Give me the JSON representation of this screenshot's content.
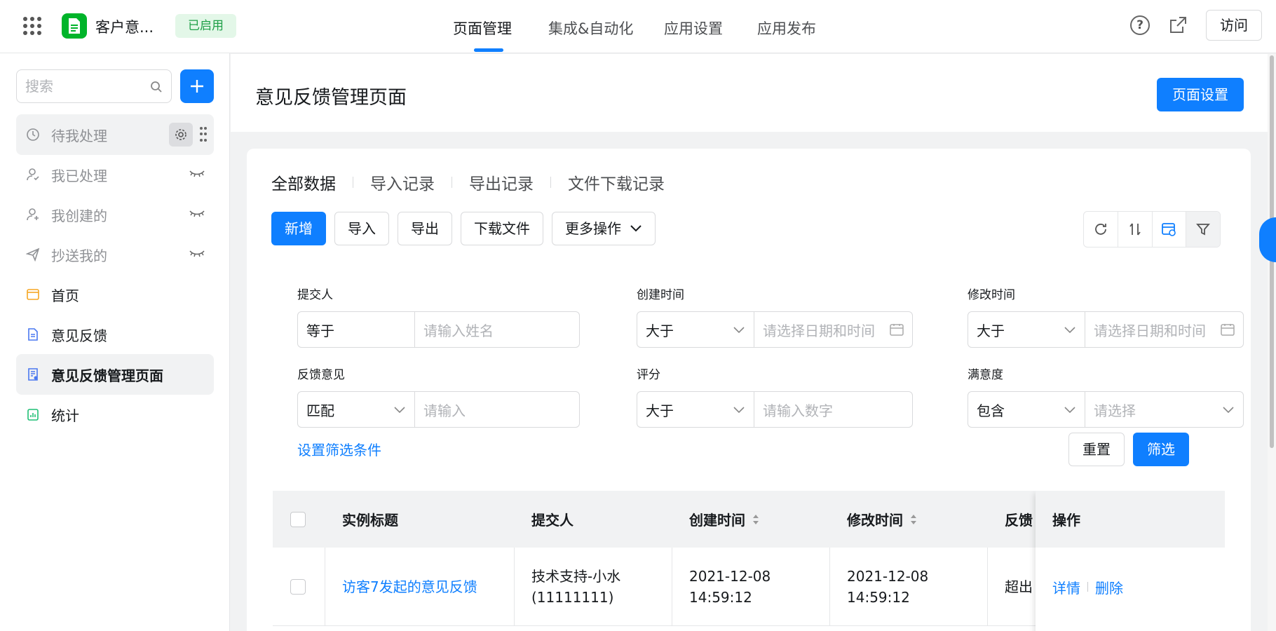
{
  "header": {
    "app_name": "客户意...",
    "status_badge": "已启用",
    "nav_tabs": [
      "页面管理",
      "集成&自动化",
      "应用设置",
      "应用发布"
    ],
    "active_tab": "页面管理",
    "visit_label": "访问"
  },
  "sidebar": {
    "search_placeholder": "搜索",
    "items": [
      {
        "label": "待我处理",
        "icon": "clock-icon"
      },
      {
        "label": "我已处理",
        "icon": "user-check-icon"
      },
      {
        "label": "我创建的",
        "icon": "user-add-icon"
      },
      {
        "label": "抄送我的",
        "icon": "send-icon"
      },
      {
        "label": "首页",
        "icon": "home-page-icon"
      },
      {
        "label": "意见反馈",
        "icon": "document-icon"
      },
      {
        "label": "意见反馈管理页面",
        "icon": "report-icon"
      },
      {
        "label": "统计",
        "icon": "chart-icon"
      }
    ]
  },
  "page": {
    "title": "意见反馈管理页面",
    "settings_label": "页面设置"
  },
  "sub_tabs": [
    "全部数据",
    "导入记录",
    "导出记录",
    "文件下载记录"
  ],
  "toolbar": {
    "add_label": "新增",
    "import_label": "导入",
    "export_label": "导出",
    "download_label": "下载文件",
    "more_label": "更多操作"
  },
  "filters": [
    {
      "label": "提交人",
      "operator": "等于",
      "placeholder": "请输入姓名"
    },
    {
      "label": "创建时间",
      "operator": "大于",
      "placeholder": "请选择日期和时间"
    },
    {
      "label": "修改时间",
      "operator": "大于",
      "placeholder": "请选择日期和时间"
    },
    {
      "label": "反馈意见",
      "operator": "匹配",
      "placeholder": "请输入"
    },
    {
      "label": "评分",
      "operator": "大于",
      "placeholder": "请输入数字"
    },
    {
      "label": "满意度",
      "operator": "包含",
      "placeholder": "请选择"
    }
  ],
  "filter_actions": {
    "set_conditions": "设置筛选条件",
    "reset": "重置",
    "apply": "筛选"
  },
  "table": {
    "columns": [
      "实例标题",
      "提交人",
      "创建时间",
      "修改时间",
      "反馈",
      "操作"
    ],
    "rows": [
      {
        "title": "访客7发起的意见反馈",
        "submitter": "技术支持-小水(11111111)",
        "created": "2021-12-08 14:59:12",
        "modified": "2021-12-08 14:59:12",
        "feedback": "超出",
        "detail_label": "详情",
        "delete_label": "删除"
      }
    ]
  },
  "colors": {
    "primary": "#0f7fff",
    "badge_bg": "#e3f7e8",
    "badge_text": "#1fa048",
    "logo_green": "#00b42a"
  }
}
